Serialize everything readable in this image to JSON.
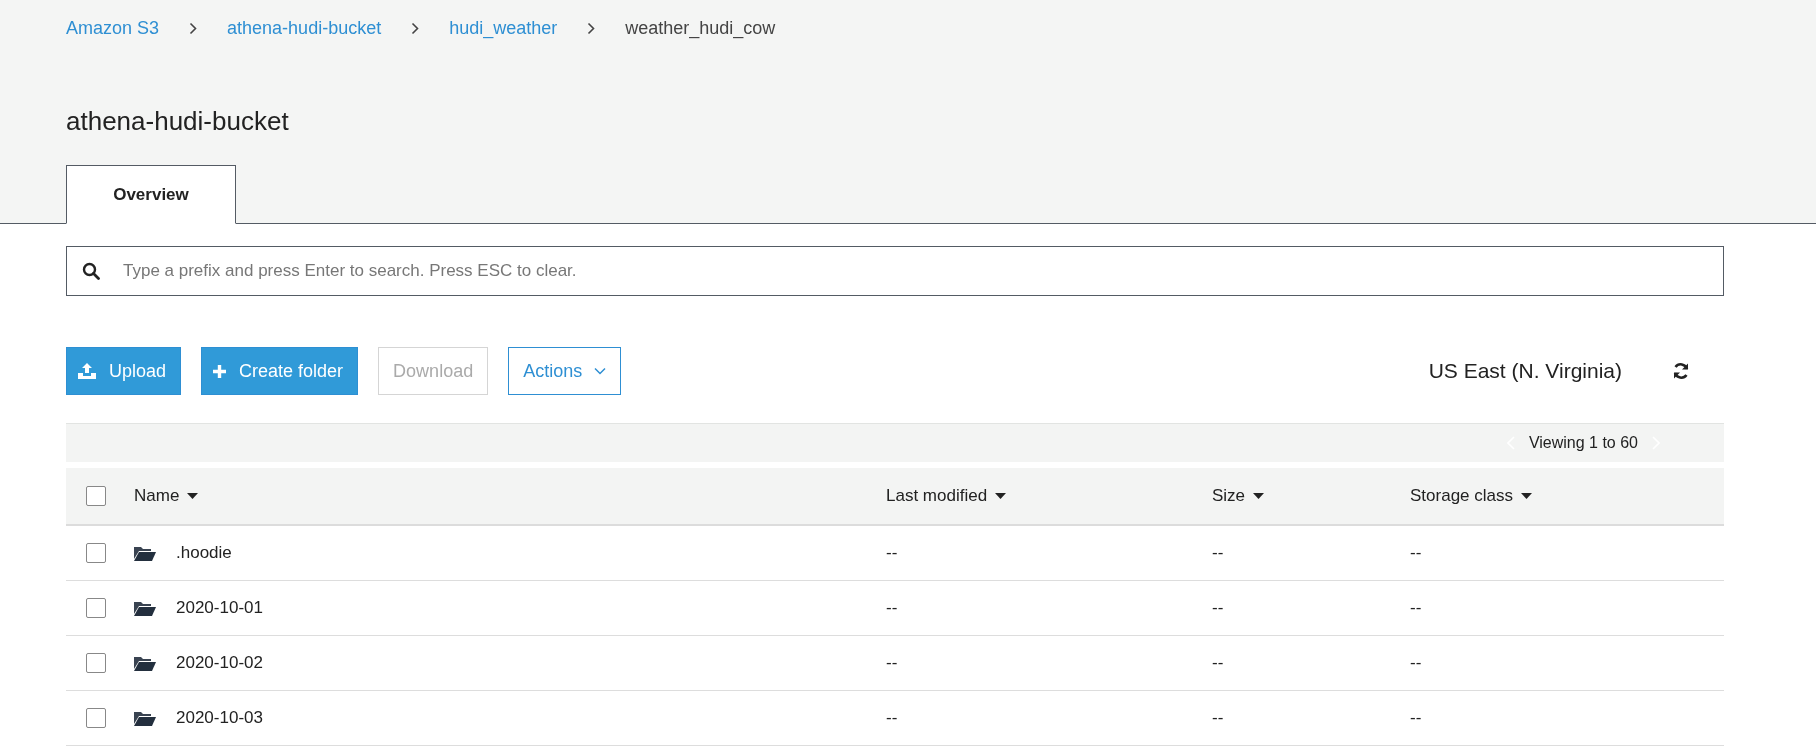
{
  "breadcrumb": [
    {
      "label": "Amazon S3",
      "link": true
    },
    {
      "label": "athena-hudi-bucket",
      "link": true
    },
    {
      "label": "hudi_weather",
      "link": true
    },
    {
      "label": "weather_hudi_cow",
      "link": false
    }
  ],
  "page_title": "athena-hudi-bucket",
  "tabs": [
    {
      "label": "Overview",
      "selected": true
    }
  ],
  "search": {
    "placeholder": "Type a prefix and press Enter to search. Press ESC to clear."
  },
  "buttons": [
    {
      "label": "Upload",
      "kind": "upload",
      "disabled": false
    },
    {
      "label": "Create folder",
      "kind": "create",
      "disabled": false
    },
    {
      "label": "Download",
      "kind": "plain",
      "disabled": true
    },
    {
      "label": "Actions",
      "kind": "menu",
      "disabled": false
    }
  ],
  "region": "US East (N. Virginia)",
  "pagination": "Viewing 1 to 60",
  "table": {
    "select_all_checked": false,
    "columns": [
      "Name",
      "Last modified",
      "Size",
      "Storage class"
    ],
    "rows": [
      {
        "checked": false,
        "name": ".hoodie",
        "last_modified": "--",
        "size": "--",
        "storage_class": "--"
      },
      {
        "checked": false,
        "name": "2020-10-01",
        "last_modified": "--",
        "size": "--",
        "storage_class": "--"
      },
      {
        "checked": false,
        "name": "2020-10-02",
        "last_modified": "--",
        "size": "--",
        "storage_class": "--"
      },
      {
        "checked": false,
        "name": "2020-10-03",
        "last_modified": "--",
        "size": "--",
        "storage_class": "--"
      }
    ]
  }
}
